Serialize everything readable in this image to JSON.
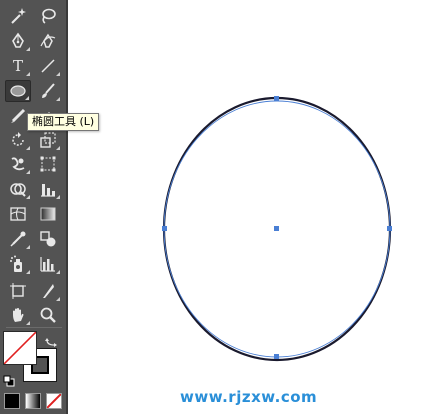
{
  "tooltip": {
    "text": "椭圆工具 (L)"
  },
  "watermark": {
    "text": "www.rjzxw.com"
  },
  "colors": {
    "toolbar_bg": "#535353",
    "tooltip_bg": "#ffffe1",
    "ellipse_fill": "#ffffff",
    "ellipse_stroke": "#1a1a2e",
    "selection": "#4a7fd4",
    "watermark": "#2a8fd8"
  },
  "tools": [
    {
      "name": "magic-wand-icon"
    },
    {
      "name": "lasso-icon"
    },
    {
      "name": "pen-icon"
    },
    {
      "name": "curvature-icon"
    },
    {
      "name": "type-icon",
      "label": "T"
    },
    {
      "name": "line-segment-icon"
    },
    {
      "name": "ellipse-icon",
      "active": true
    },
    {
      "name": "paintbrush-icon"
    },
    {
      "name": "pencil-icon"
    },
    {
      "name": "eraser-icon"
    },
    {
      "name": "rotate-icon"
    },
    {
      "name": "scale-icon"
    },
    {
      "name": "warp-icon"
    },
    {
      "name": "free-transform-icon"
    },
    {
      "name": "shape-builder-icon"
    },
    {
      "name": "chart-icon"
    },
    {
      "name": "mesh-icon"
    },
    {
      "name": "gradient-icon"
    },
    {
      "name": "eyedropper-icon"
    },
    {
      "name": "blend-icon"
    },
    {
      "name": "symbol-sprayer-icon"
    },
    {
      "name": "column-graph-icon"
    },
    {
      "name": "artboard-icon"
    },
    {
      "name": "slice-icon"
    },
    {
      "name": "hand-icon"
    },
    {
      "name": "zoom-icon"
    }
  ]
}
